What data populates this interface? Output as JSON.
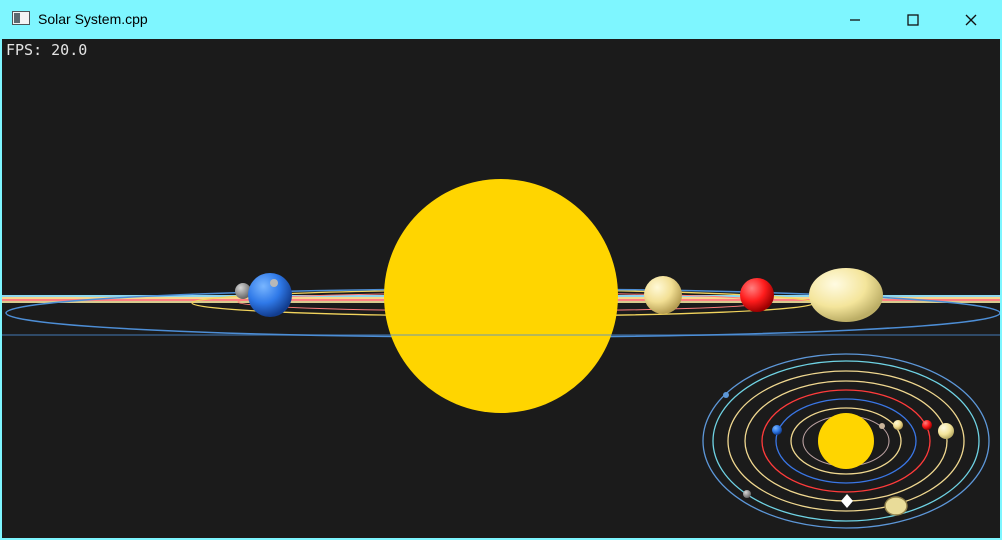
{
  "window": {
    "title": "Solar System.cpp",
    "titlebar_color": "#7ef6ff",
    "buttons": [
      "minimize",
      "maximize",
      "close"
    ]
  },
  "overlay": {
    "fps_text": "FPS: 20.0"
  },
  "scene": {
    "background": "#1b1b1b",
    "sun_color": "#ffd500",
    "planet_colors": {
      "earth": "#2f79e8",
      "venus": "#f2df94",
      "mars": "#ff1c1c",
      "jupiter": "#f4e59b",
      "saturn": "#d9cc8a"
    }
  },
  "minimap": {
    "label": "top-down orbit view"
  }
}
